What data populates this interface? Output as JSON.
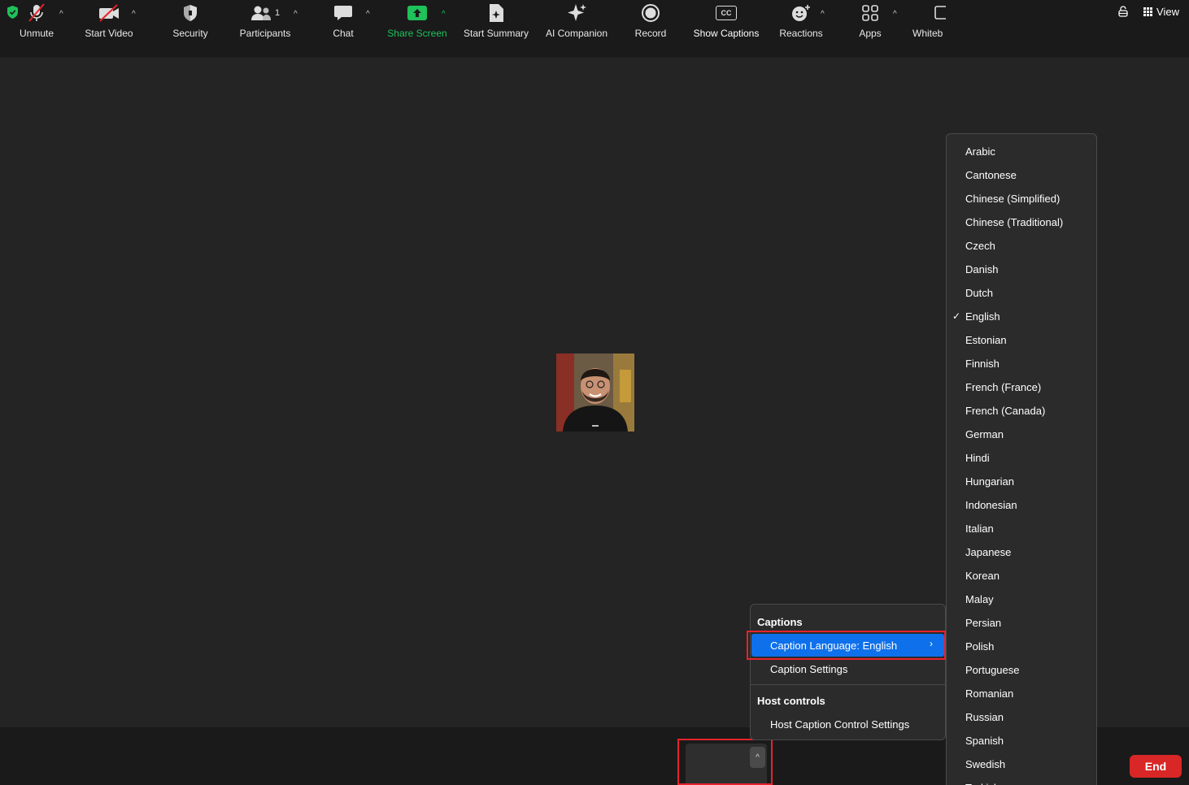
{
  "top_bar": {
    "view_label": "View"
  },
  "toolbar": {
    "unmute": "Unmute",
    "start_video": "Start Video",
    "security": "Security",
    "participants": "Participants",
    "participants_count": "1",
    "chat": "Chat",
    "share_screen": "Share Screen",
    "start_summary": "Start Summary",
    "ai_companion": "AI Companion",
    "record": "Record",
    "show_captions": "Show Captions",
    "cc_glyph": "CC",
    "reactions": "Reactions",
    "apps": "Apps",
    "whiteboards": "Whiteb",
    "end": "End"
  },
  "captions_menu": {
    "captions_header": "Captions",
    "caption_language": "Caption Language: English",
    "caption_settings": "Caption Settings",
    "host_controls_header": "Host controls",
    "host_caption_settings": "Host Caption Control Settings"
  },
  "language_submenu": {
    "selected": "English",
    "items": [
      "Arabic",
      "Cantonese",
      "Chinese (Simplified)",
      "Chinese (Traditional)",
      "Czech",
      "Danish",
      "Dutch",
      "English",
      "Estonian",
      "Finnish",
      "French (France)",
      "French (Canada)",
      "German",
      "Hindi",
      "Hungarian",
      "Indonesian",
      "Italian",
      "Japanese",
      "Korean",
      "Malay",
      "Persian",
      "Polish",
      "Portuguese",
      "Romanian",
      "Russian",
      "Spanish",
      "Swedish",
      "Turkish"
    ]
  },
  "colors": {
    "accent_blue": "#0e71eb",
    "share_green": "#1ec15a",
    "end_red": "#d92626",
    "highlight_red": "#e5232d"
  }
}
